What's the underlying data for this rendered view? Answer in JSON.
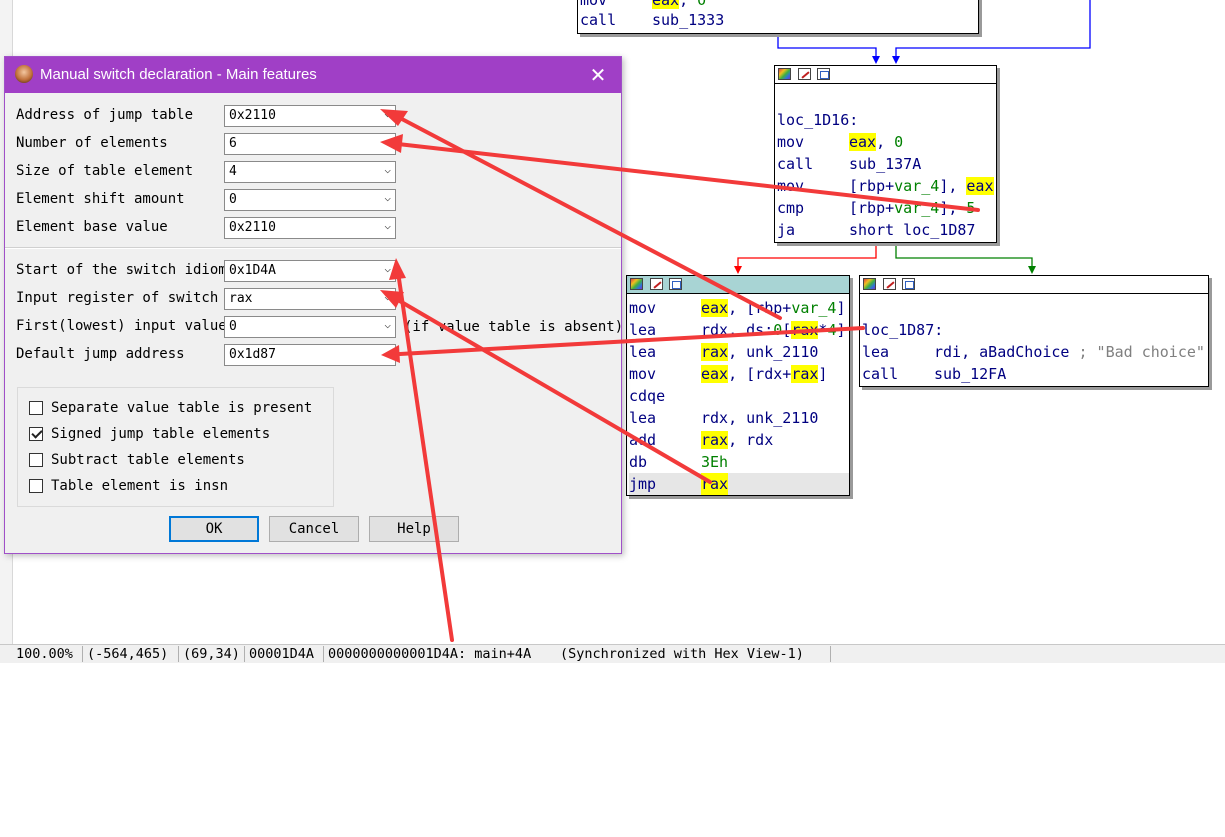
{
  "graph": {
    "top_block": {
      "lines": [
        {
          "mn": "mov",
          "op": "eax, 0"
        },
        {
          "mn": "call",
          "op": "sub_1333"
        }
      ]
    },
    "block_1d16": {
      "label": "loc_1D16:",
      "lines": [
        {
          "mn": "mov",
          "op": "eax, 0"
        },
        {
          "mn": "call",
          "op": "sub_137A"
        },
        {
          "mn": "mov",
          "op": "[rbp+var_4], eax"
        },
        {
          "mn": "cmp",
          "op": "[rbp+var_4], 5"
        },
        {
          "mn": "ja",
          "op": "short loc_1D87"
        }
      ]
    },
    "switch_block": {
      "lines": [
        {
          "mn": "mov",
          "op": "eax, [rbp+var_4]"
        },
        {
          "mn": "lea",
          "op": "rdx, ds:0[rax*4]"
        },
        {
          "mn": "lea",
          "op": "rax, unk_2110"
        },
        {
          "mn": "mov",
          "op": "eax, [rdx+rax]"
        },
        {
          "mn": "cdqe",
          "op": ""
        },
        {
          "mn": "lea",
          "op": "rdx, unk_2110"
        },
        {
          "mn": "add",
          "op": "rax, rdx"
        },
        {
          "mn": "db",
          "op": "3Eh"
        },
        {
          "mn": "jmp",
          "op": "rax"
        }
      ]
    },
    "block_1d87": {
      "label": "loc_1D87:",
      "lines": [
        {
          "mn": "lea",
          "op": "rdi, aBadChoice",
          "comment": "; \"Bad choice\""
        },
        {
          "mn": "call",
          "op": "sub_12FA"
        }
      ]
    }
  },
  "dialog": {
    "title": "Manual switch declaration - Main features",
    "fields": [
      {
        "label": "Address of jump table",
        "value": "0x2110"
      },
      {
        "label": "Number of elements",
        "value": "6"
      },
      {
        "label": "Size of table element",
        "value": "4"
      },
      {
        "label": "Element shift amount",
        "value": "0"
      },
      {
        "label": "Element base value",
        "value": "0x2110"
      },
      {
        "label": "Start of the switch idiom",
        "value": "0x1D4A"
      },
      {
        "label": "Input register of switch",
        "value": "rax"
      },
      {
        "label": "First(lowest) input value",
        "value": "0",
        "note": "(if value table is absent)"
      },
      {
        "label": "Default jump address",
        "value": "0x1d87"
      }
    ],
    "checkboxes": [
      {
        "label": "Separate value table is present",
        "checked": false
      },
      {
        "label": "Signed jump table elements",
        "checked": true
      },
      {
        "label": "Subtract table elements",
        "checked": false
      },
      {
        "label": "Table element is insn",
        "checked": false
      }
    ],
    "buttons": {
      "ok": "OK",
      "cancel": "Cancel",
      "help": "Help"
    }
  },
  "status_bar": {
    "zoom": "100.00%",
    "coords1": "(-564,465)",
    "coords2": "(69,34)",
    "offset": "00001D4A",
    "address": "0000000000001D4A: main+4A",
    "sync": "(Synchronized with Hex View-1)"
  }
}
